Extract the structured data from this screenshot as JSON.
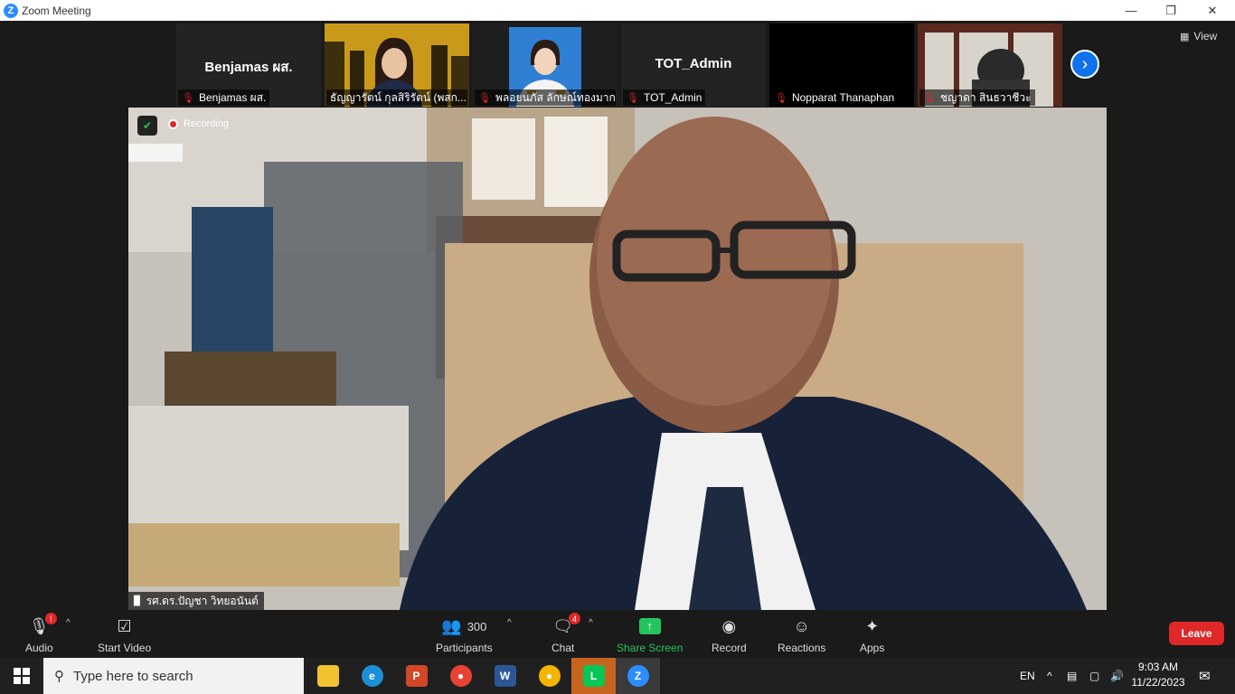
{
  "window": {
    "title": "Zoom Meeting"
  },
  "thumbnails": [
    {
      "name": "Benjamas ผส.",
      "center_name": "Benjamas ผส.",
      "type": "name"
    },
    {
      "name": "ธัญญารัตน์ กุลสิริรัตน์ (พสก...",
      "type": "video"
    },
    {
      "name": "พลอยนภัส ลักษณ์ทองมาก",
      "type": "video"
    },
    {
      "name": "TOT_Admin",
      "center_name": "TOT_Admin",
      "type": "name"
    },
    {
      "name": "Nopparat Thanaphan",
      "type": "black"
    },
    {
      "name": "ชญาดา สินธวาชีวะ",
      "type": "video"
    }
  ],
  "view_label": "View",
  "main_video": {
    "recording_label": "Recording",
    "speaker_name": "รศ.ดร.ปัญชา วิทยอนันต์"
  },
  "toolbar": {
    "audio": "Audio",
    "start_video": "Start Video",
    "participants": "Participants",
    "participants_count": "300",
    "chat": "Chat",
    "chat_badge": "4",
    "share_screen": "Share Screen",
    "record": "Record",
    "reactions": "Reactions",
    "apps": "Apps",
    "leave": "Leave",
    "audio_badge": "!"
  },
  "taskbar": {
    "search_placeholder": "Type here to search",
    "language": "EN",
    "time": "9:03 AM",
    "date": "11/22/2023",
    "apps": [
      "file-explorer",
      "edge",
      "powerpoint",
      "chrome-profile",
      "word",
      "chrome",
      "line",
      "active",
      "zoom"
    ]
  },
  "colors": {
    "zoom_blue": "#2d8cff",
    "leave_red": "#e02828",
    "share_green": "#23c55e"
  }
}
